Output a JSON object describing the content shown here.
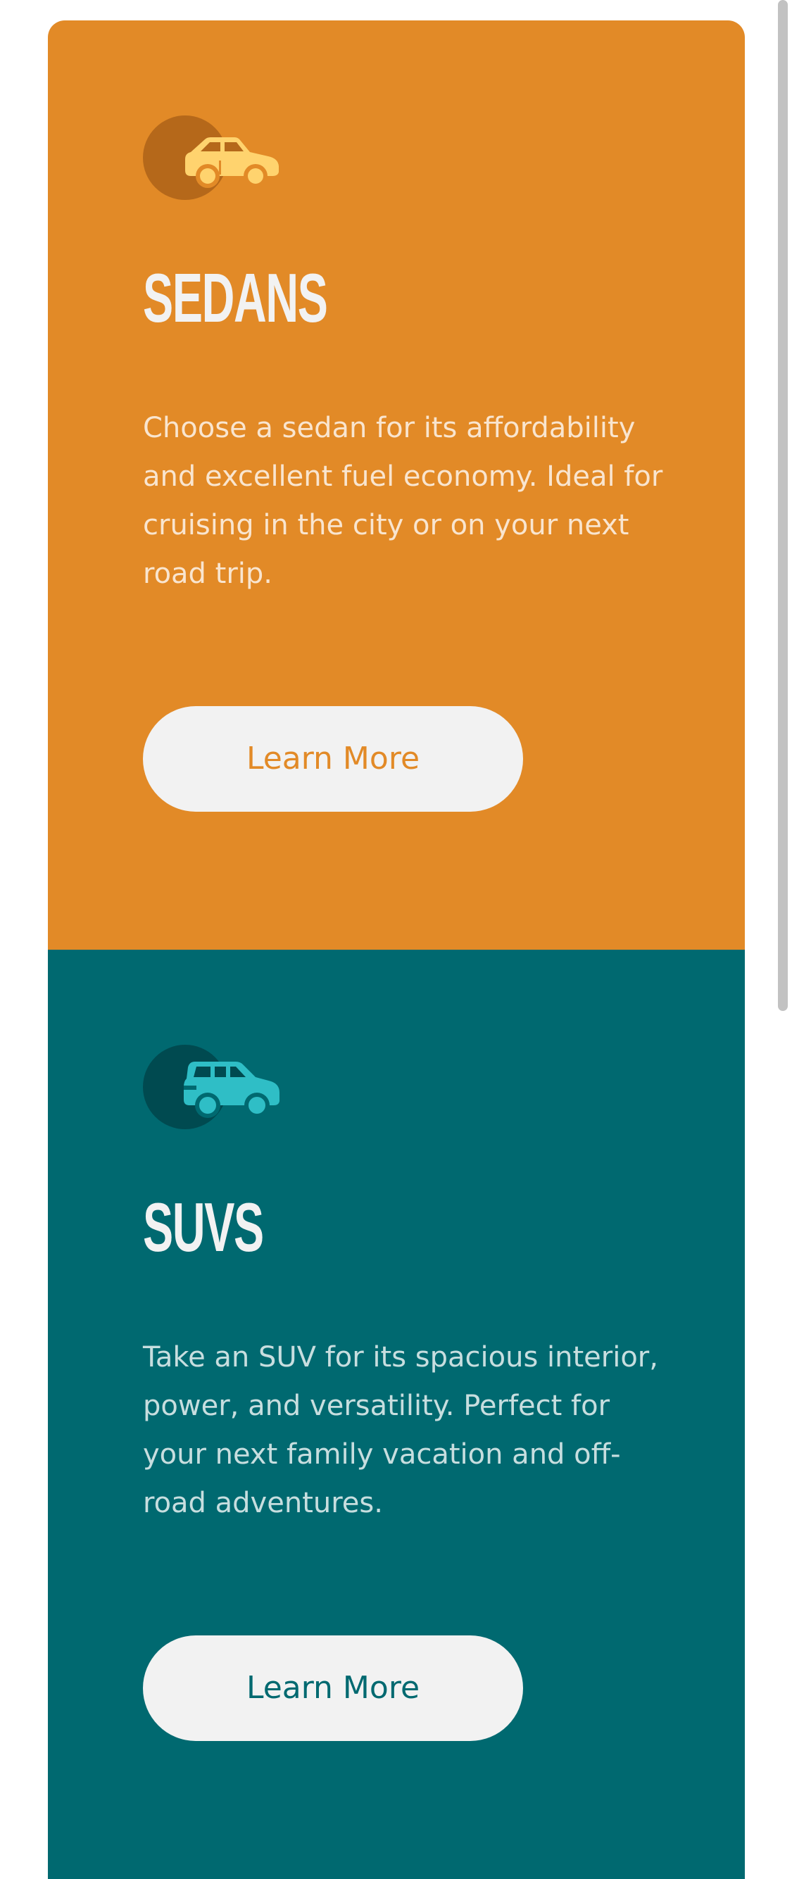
{
  "cards": [
    {
      "id": "sedans",
      "icon": "sedan-car-icon",
      "title": "SEDANS",
      "description": "Choose a sedan for its affordability and excellent fuel economy. Ideal for cruising in the city or on your next road trip.",
      "button_label": "Learn More",
      "colors": {
        "background": "#e28a27",
        "icon": "#ffd36e",
        "icon_circle": "#b5681a"
      }
    },
    {
      "id": "suvs",
      "icon": "suv-car-icon",
      "title": "SUVS",
      "description": "Take an SUV for its spacious interior, power, and versatility. Perfect for your next family vacation and off-road adventures.",
      "button_label": "Learn More",
      "colors": {
        "background": "#006970",
        "icon": "#2fbec6",
        "icon_circle": "#004a50"
      }
    }
  ],
  "colors": {
    "button_background": "#f2f2f2",
    "title_text": "#f2f2f2"
  }
}
